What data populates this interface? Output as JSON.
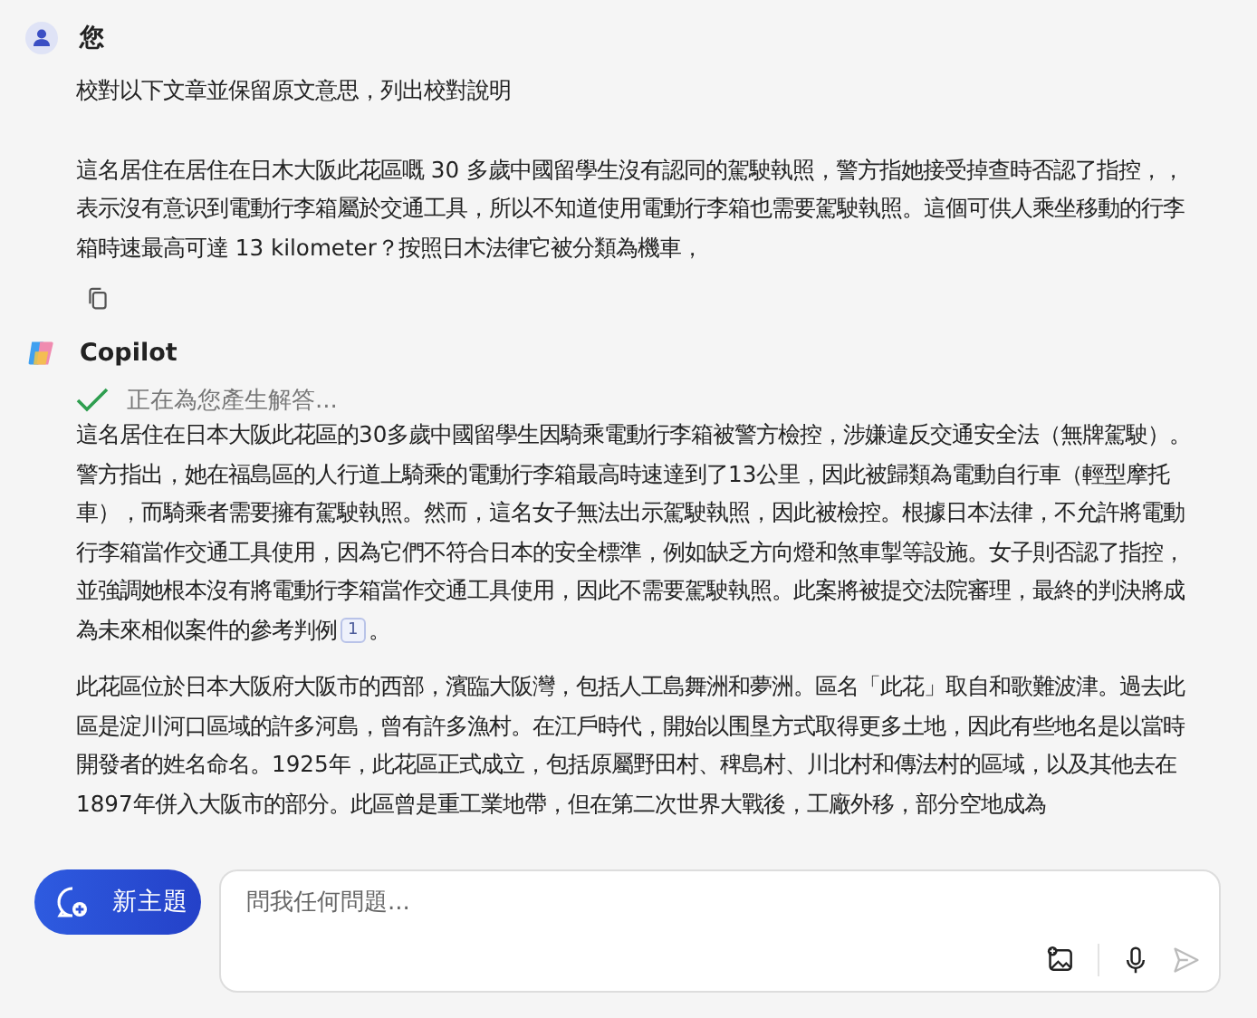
{
  "user_message": {
    "author": "您",
    "paragraphs": [
      "校對以下文章並保留原文意思，列出校對說明",
      "這名居住在居住在日木大阪此花區嘅 30 多歲中國留學生沒有認同的駕駛執照，警方指她接受掉查時否認了指控，，表示沒有意识到電動行李箱屬於交通工具，所以不知道使用電動行李箱也需要駕駛執照。這個可供人乘坐移動的行李箱時速最高可達 13 kilometer？按照日木法律它被分類為機車，"
    ]
  },
  "assistant_message": {
    "author": "Copilot",
    "status": "正在為您產生解答...",
    "status_done": true,
    "paragraphs": [
      {
        "text": "這名居住在日本大阪此花區的30多歲中國留學生因騎乘電動行李箱被警方檢控，涉嫌違反交通安全法（無牌駕駛）。警方指出，她在福島區的人行道上騎乘的電動行李箱最高時速達到了13公里，因此被歸類為電動自行車（輕型摩托車），而騎乘者需要擁有駕駛執照。然而，這名女子無法出示駕駛執照，因此被檢控。根據日本法律，不允許將電動行李箱當作交通工具使用，因為它們不符合日本的安全標準，例如缺乏方向燈和煞車掣等設施。女子則否認了指控，並強調她根本沒有將電動行李箱當作交通工具使用，因此不需要駕駛執照。此案將被提交法院審理，最終的判決將成為未來相似案件的參考判例",
        "citation": "1",
        "tail": "。"
      },
      {
        "text": "此花區位於日本大阪府大阪市的西部，濱臨大阪灣，包括人工島舞洲和夢洲。區名「此花」取自和歌難波津。過去此區是淀川河口區域的許多河島，曾有許多漁村。在江戶時代，開始以围垦方式取得更多土地，因此有些地名是以當時開發者的姓名命名。1925年，此花區正式成立，包括原屬野田村、稗島村、川北村和傳法村的區域，以及其他去在1897年併入大阪市的部分。此區曾是重工業地帶，但在第二次世界大戰後，工廠外移，部分空地成為"
      }
    ]
  },
  "new_topic_button": {
    "label": "新主題"
  },
  "composer": {
    "placeholder": "問我任何問題..."
  }
}
